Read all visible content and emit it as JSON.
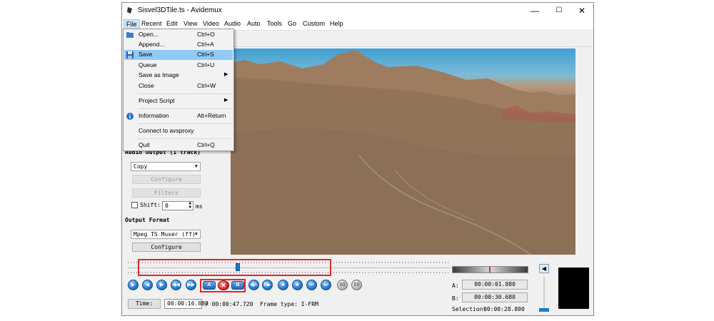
{
  "window": {
    "title": "Sisvel3DTile.ts - Avidemux",
    "controls": {
      "minimize": "—",
      "maximize": "☐",
      "close": "✕"
    }
  },
  "menubar": [
    "File",
    "Recent",
    "Edit",
    "View",
    "Video",
    "Audio",
    "Auto",
    "Tools",
    "Go",
    "Custom",
    "Help"
  ],
  "file_menu": [
    {
      "label": "Open...",
      "shortcut": "Ctrl+O",
      "icon": "folder-open-icon"
    },
    {
      "label": "Append...",
      "shortcut": "Ctrl+A"
    },
    {
      "label": "Save",
      "shortcut": "Ctrl+S",
      "icon": "save-icon",
      "highlighted": true
    },
    {
      "label": "Queue",
      "shortcut": "Ctrl+U"
    },
    {
      "label": "Save as Image",
      "submenu": true
    },
    {
      "label": "Close",
      "shortcut": "Ctrl+W"
    },
    {
      "label": "Project Script",
      "submenu": true
    },
    {
      "label": "Information",
      "shortcut": "Alt+Return",
      "icon": "info-icon"
    },
    {
      "label": "Connect to avsproxy"
    },
    {
      "label": "Quit",
      "shortcut": "Ctrl+Q"
    }
  ],
  "left_panel": {
    "audio_output_label": "Audio Output (1 track)",
    "audio_codec": "Copy",
    "configure_audio": "Configure",
    "filters": "Filters",
    "shift_label": "Shift:",
    "shift_value": "0",
    "shift_unit": "ms",
    "output_format_label": "Output Format",
    "output_format": "Mpeg TS Muxer (ff)",
    "configure_format": "Configure"
  },
  "timeline": {
    "position": 0.34
  },
  "bottom": {
    "time_button": "Time:",
    "current_time": "00:00:16.880",
    "total_time": "/ 00:00:47.720",
    "frame_type": "Frame type: I-FRM",
    "a_label": "A:",
    "a_value": "00:00:01.880",
    "b_label": "B:",
    "b_value": "00:00:30.680",
    "selection_label": "Selection:",
    "selection_value": "00:00:28.800"
  },
  "ab_buttons": {
    "a": "A",
    "b": "B",
    "clear": "✕"
  },
  "colors": {
    "accent": "#1f78d1",
    "highlight_red": "#e0262a",
    "menu_highlight": "#91c9f7"
  }
}
